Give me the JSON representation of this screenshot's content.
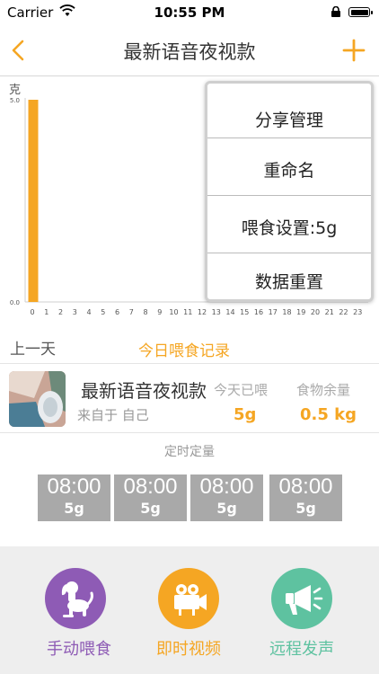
{
  "status": {
    "carrier": "Carrier",
    "time": "10:55 PM"
  },
  "nav": {
    "title": "最新语音夜视款"
  },
  "chart_data": {
    "type": "bar",
    "ylabel": "克",
    "ylim": [
      0,
      5.0
    ],
    "ytick_labels": [
      "0.0",
      "5.0"
    ],
    "categories": [
      "0",
      "1",
      "2",
      "3",
      "4",
      "5",
      "6",
      "7",
      "8",
      "9",
      "10",
      "11",
      "12",
      "13",
      "14",
      "15",
      "16",
      "17",
      "18",
      "19",
      "20",
      "21",
      "22",
      "23"
    ],
    "values": [
      5.0,
      0,
      0,
      0,
      0,
      0,
      0,
      0,
      0,
      0,
      0,
      0,
      0,
      0,
      0,
      0,
      0,
      0,
      0,
      0,
      0,
      0,
      0,
      0
    ],
    "bar_color": "#f5a623"
  },
  "menu": {
    "items": [
      "分享管理",
      "重命名",
      "喂食设置:5g",
      "数据重置"
    ]
  },
  "record": {
    "prev_day": "上一天",
    "today_title": "今日喂食记录"
  },
  "device": {
    "name": "最新语音夜视款",
    "from": "来自于 自己",
    "fed_label": "今天已喂",
    "fed_value": "5g",
    "remain_label": "食物余量",
    "remain_value": "0.5 kg"
  },
  "timers": {
    "header": "定时定量",
    "items": [
      {
        "time": "08:00",
        "amount": "5g"
      },
      {
        "time": "08:00",
        "amount": "5g"
      },
      {
        "time": "08:00",
        "amount": "5g"
      },
      {
        "time": "08:00",
        "amount": "5g"
      }
    ]
  },
  "actions": [
    {
      "label": "手动喂食",
      "icon": "dog-icon",
      "color": "#8e5bb5"
    },
    {
      "label": "即时视频",
      "icon": "video-camera-icon",
      "color": "#f5a623"
    },
    {
      "label": "远程发声",
      "icon": "megaphone-icon",
      "color": "#5ec2a0"
    }
  ]
}
